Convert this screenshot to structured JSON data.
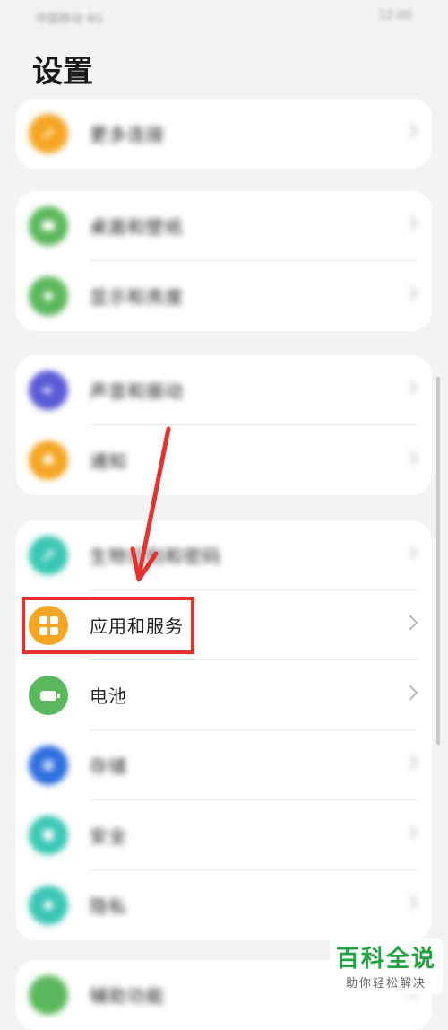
{
  "status_bar": {
    "left_text": "中国移动 4G",
    "right_text": "12:00"
  },
  "page_title": "设置",
  "groups": [
    {
      "rows": [
        {
          "label": "更多连接",
          "icon": "link-icon",
          "color": "#f5a623",
          "blurred": true
        }
      ]
    },
    {
      "rows": [
        {
          "label": "桌面和壁纸",
          "icon": "wallpaper-icon",
          "color": "#5cb85c",
          "blurred": true
        },
        {
          "label": "显示和亮度",
          "icon": "display-icon",
          "color": "#5cb85c",
          "blurred": true
        }
      ]
    },
    {
      "rows": [
        {
          "label": "声音和振动",
          "icon": "sound-icon",
          "color": "#5b5bd6",
          "blurred": true
        },
        {
          "label": "通知",
          "icon": "notification-icon",
          "color": "#f5a623",
          "blurred": true
        }
      ]
    },
    {
      "rows": [
        {
          "label": "生物识别和密码",
          "icon": "key-icon",
          "color": "#3cc7b4",
          "blurred": true
        },
        {
          "label": "应用和服务",
          "icon": "apps-icon",
          "color": "#f5a623",
          "blurred": false
        },
        {
          "label": "电池",
          "icon": "battery-icon",
          "color": "#5cb85c",
          "blurred": false
        },
        {
          "label": "存储",
          "icon": "storage-icon",
          "color": "#2f6fe0",
          "blurred": true
        },
        {
          "label": "安全",
          "icon": "security-icon",
          "color": "#3cc7b4",
          "blurred": true
        },
        {
          "label": "隐私",
          "icon": "privacy-icon",
          "color": "#3cc7b4",
          "blurred": true
        }
      ]
    },
    {
      "rows": [
        {
          "label": "辅助功能",
          "icon": "accessibility-icon",
          "color": "#5cb85c",
          "blurred": true
        }
      ]
    }
  ],
  "watermark": {
    "title": "百科全说",
    "subtitle": "助你轻松解决"
  },
  "annotation": {
    "highlight_color": "#e8302c"
  }
}
